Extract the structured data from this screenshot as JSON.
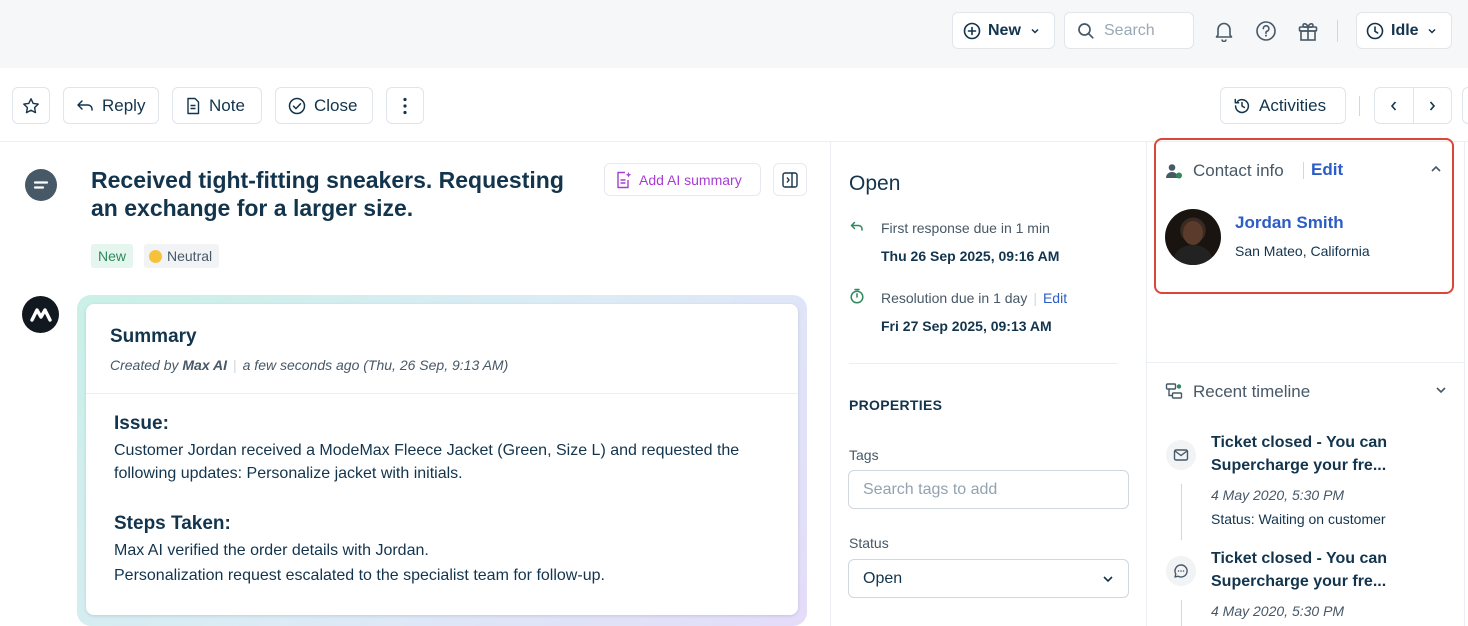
{
  "topbar": {
    "new_label": "New",
    "search_placeholder": "Search",
    "status_label": "Idle"
  },
  "actions": {
    "reply": "Reply",
    "note": "Note",
    "close": "Close",
    "activities": "Activities"
  },
  "ticket": {
    "title": "Received tight-fitting sneakers. Requesting an exchange for a larger size.",
    "ai_summary_button": "Add AI summary",
    "status_badge": "New",
    "sentiment": "Neutral"
  },
  "summary": {
    "heading": "Summary",
    "created_by_prefix": "Created by",
    "created_by": "Max AI",
    "created_when": "a few seconds ago (Thu, 26 Sep, 9:13 AM)",
    "issue_heading": "Issue:",
    "issue_text": "Customer Jordan received a ModeMax Fleece Jacket (Green, Size L) and requested the following updates: Personalize jacket with initials.",
    "steps_heading": "Steps Taken:",
    "steps_line1": "Max AI verified the order details with Jordan.",
    "steps_line2": "Personalization request escalated to the specialist team for follow-up."
  },
  "sla": {
    "status": "Open",
    "first_response_label": "First response due in 1 min",
    "first_response_date": "Thu 26 Sep 2025, 09:16 AM",
    "resolution_label": "Resolution due in 1 day",
    "resolution_edit": "Edit",
    "resolution_date": "Fri 27 Sep 2025, 09:13 AM"
  },
  "properties": {
    "heading": "PROPERTIES",
    "tags_label": "Tags",
    "tags_placeholder": "Search tags to add",
    "status_label": "Status",
    "status_value": "Open"
  },
  "contact": {
    "heading": "Contact info",
    "edit": "Edit",
    "name": "Jordan Smith",
    "location": "San Mateo, California"
  },
  "timeline": {
    "heading": "Recent timeline",
    "items": [
      {
        "title": "Ticket closed - You can Supercharge your fre...",
        "date": "4 May 2020, 5:30 PM",
        "status": "Status: Waiting on customer",
        "icon": "envelope-icon"
      },
      {
        "title": "Ticket closed - You can Supercharge your fre...",
        "date": "4 May 2020, 5:30 PM",
        "icon": "chat-bubble-icon"
      }
    ]
  },
  "colors": {
    "accent_blue": "#2c5cc5",
    "ai_purple": "#a63ed1",
    "highlight_red": "#d9473a",
    "new_badge_green": "#2d8a5b"
  }
}
